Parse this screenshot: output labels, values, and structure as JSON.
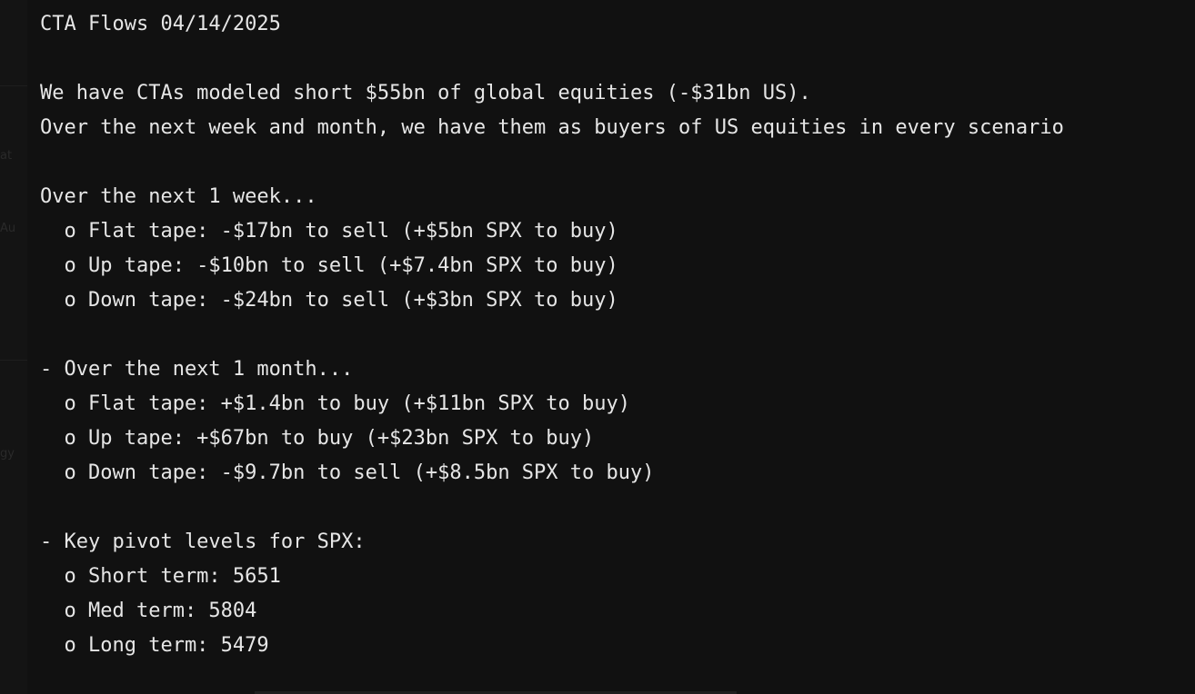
{
  "document": {
    "title": "CTA Flows 04/14/2025",
    "intro": [
      "We have CTAs modeled short $55bn of global equities (-$31bn US).",
      "Over the next week and month, we have them as buyers of US equities in every scenario"
    ],
    "week": {
      "heading": "Over the next 1 week...",
      "items": [
        "  o Flat tape: -$17bn to sell (+$5bn SPX to buy)",
        "  o Up tape: -$10bn to sell (+$7.4bn SPX to buy)",
        "  o Down tape: -$24bn to sell (+$3bn SPX to buy)"
      ]
    },
    "month": {
      "heading": "- Over the next 1 month...",
      "items": [
        "  o Flat tape: +$1.4bn to buy (+$11bn SPX to buy)",
        "  o Up tape: +$67bn to buy (+$23bn SPX to buy)",
        "  o Down tape: -$9.7bn to sell (+$8.5bn SPX to buy)"
      ]
    },
    "pivots": {
      "heading": "- Key pivot levels for SPX:",
      "items": [
        "  o Short term: 5651",
        "  o Med term: 5804",
        "  o Long term: 5479"
      ]
    }
  },
  "sidebar_fragments": [
    "at",
    "Au",
    "gy"
  ]
}
